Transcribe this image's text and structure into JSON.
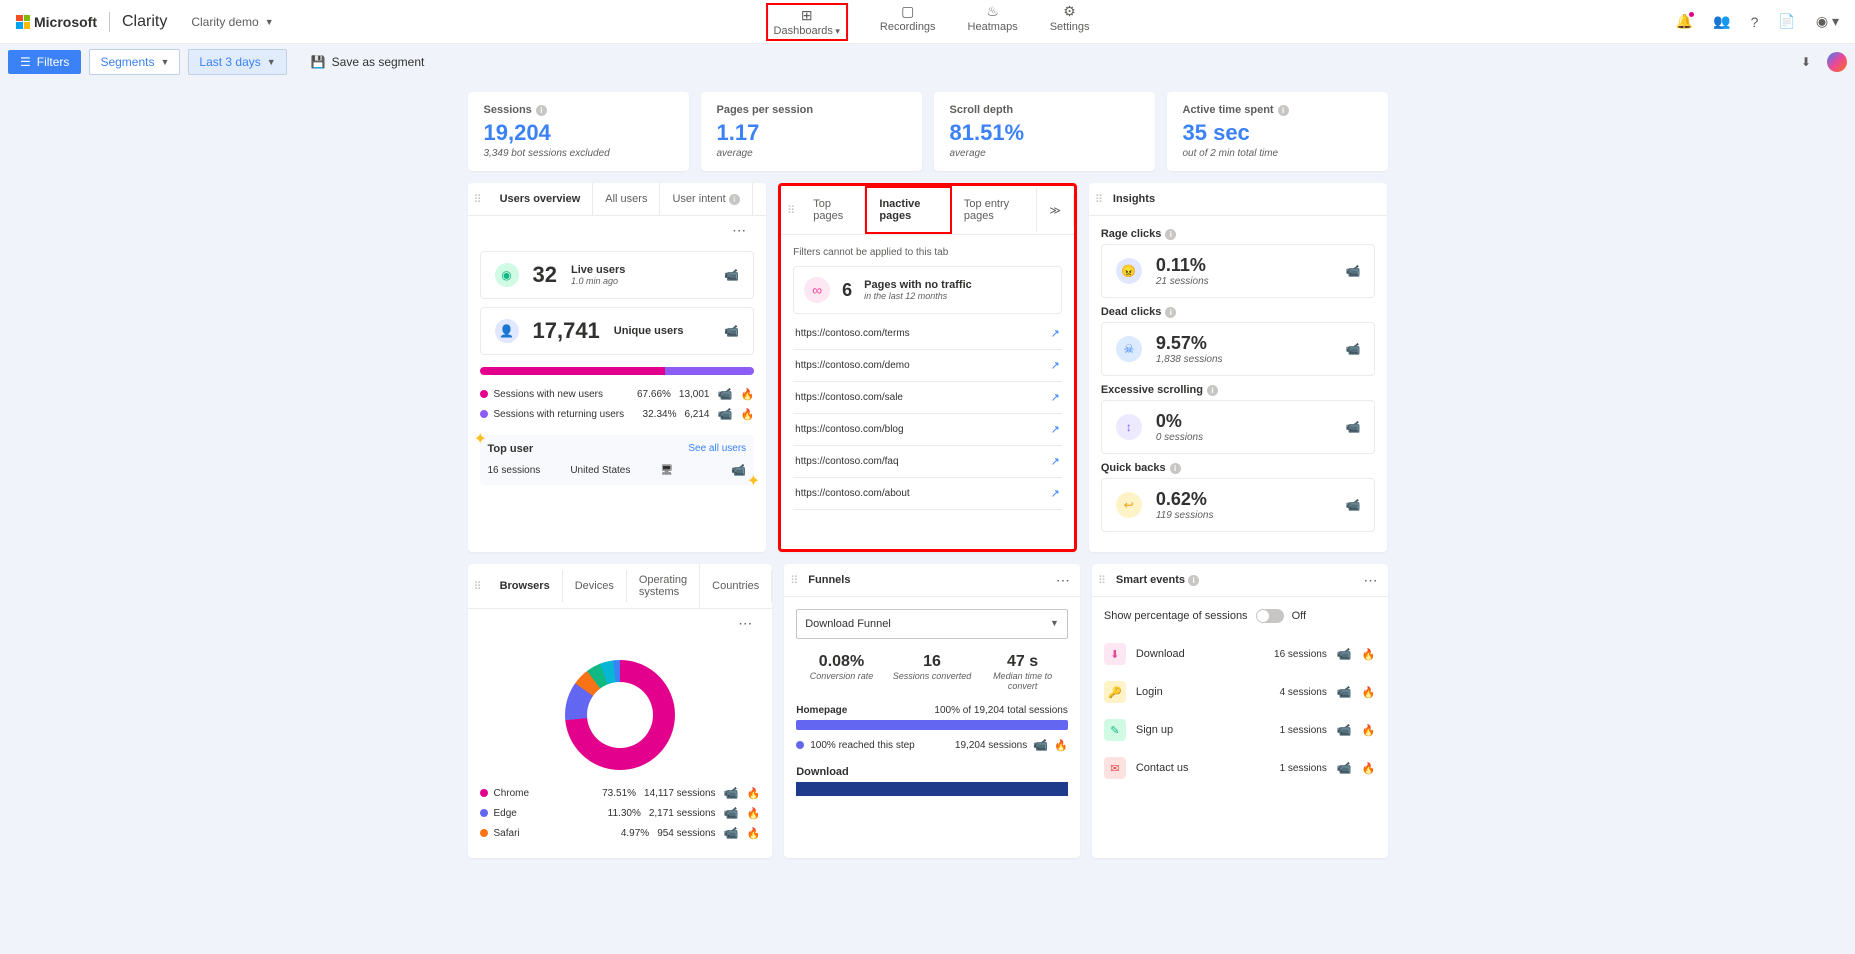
{
  "header": {
    "brand": "Microsoft",
    "product": "Clarity",
    "project": "Clarity demo",
    "nav": {
      "dashboards": "Dashboards",
      "recordings": "Recordings",
      "heatmaps": "Heatmaps",
      "settings": "Settings"
    }
  },
  "filterbar": {
    "filters": "Filters",
    "segments": "Segments",
    "date": "Last 3 days",
    "save_segment": "Save as segment"
  },
  "stats": {
    "sessions": {
      "label": "Sessions",
      "value": "19,204",
      "sub": "3,349 bot sessions excluded"
    },
    "pps": {
      "label": "Pages per session",
      "value": "1.17",
      "sub": "average"
    },
    "scroll": {
      "label": "Scroll depth",
      "value": "81.51%",
      "sub": "average"
    },
    "active": {
      "label": "Active time spent",
      "value": "35 sec",
      "sub": "out of 2 min total time"
    }
  },
  "users": {
    "tabs": {
      "overview": "Users overview",
      "all": "All users",
      "intent": "User intent"
    },
    "live": {
      "value": "32",
      "label": "Live users",
      "sub": "1.0 min ago"
    },
    "unique": {
      "value": "17,741",
      "label": "Unique users"
    },
    "new": {
      "label": "Sessions with new users",
      "pct": "67.66%",
      "count": "13,001"
    },
    "ret": {
      "label": "Sessions with returning users",
      "pct": "32.34%",
      "count": "6,214"
    },
    "topuser": {
      "title": "Top user",
      "see_all": "See all users",
      "sessions": "16 sessions",
      "country": "United States"
    }
  },
  "pages": {
    "tabs": {
      "top": "Top pages",
      "inactive": "Inactive pages",
      "entry": "Top entry pages"
    },
    "filter_note": "Filters cannot be applied to this tab",
    "head": {
      "value": "6",
      "label": "Pages with no traffic",
      "sub": "in the last 12 months"
    },
    "rows": [
      "https://contoso.com/terms",
      "https://contoso.com/demo",
      "https://contoso.com/sale",
      "https://contoso.com/blog",
      "https://contoso.com/faq",
      "https://contoso.com/about"
    ]
  },
  "insights": {
    "title": "Insights",
    "rage": {
      "label": "Rage clicks",
      "value": "0.11%",
      "sub": "21 sessions"
    },
    "dead": {
      "label": "Dead clicks",
      "value": "9.57%",
      "sub": "1,838 sessions"
    },
    "scroll": {
      "label": "Excessive scrolling",
      "value": "0%",
      "sub": "0 sessions"
    },
    "quick": {
      "label": "Quick backs",
      "value": "0.62%",
      "sub": "119 sessions"
    }
  },
  "browsers": {
    "tabs": {
      "browsers": "Browsers",
      "devices": "Devices",
      "os": "Operating systems",
      "countries": "Countries"
    },
    "rows": {
      "chrome": {
        "name": "Chrome",
        "pct": "73.51%",
        "sessions": "14,117 sessions"
      },
      "edge": {
        "name": "Edge",
        "pct": "11.30%",
        "sessions": "2,171 sessions"
      },
      "safari": {
        "name": "Safari",
        "pct": "4.97%",
        "sessions": "954 sessions"
      }
    }
  },
  "funnels": {
    "title": "Funnels",
    "select": "Download Funnel",
    "conv": {
      "value": "0.08%",
      "label": "Conversion rate"
    },
    "sess": {
      "value": "16",
      "label": "Sessions converted"
    },
    "time": {
      "value": "47 s",
      "label": "Median time to convert"
    },
    "step1": {
      "name": "Homepage",
      "right": "100% of 19,204 total sessions",
      "detail": "100% reached this step",
      "count": "19,204 sessions"
    },
    "step2": {
      "name": "Download"
    }
  },
  "events": {
    "title": "Smart events",
    "toggle_label": "Show percentage of sessions",
    "toggle_state": "Off",
    "rows": {
      "download": {
        "name": "Download",
        "sessions": "16 sessions"
      },
      "login": {
        "name": "Login",
        "sessions": "4 sessions"
      },
      "signup": {
        "name": "Sign up",
        "sessions": "1 sessions"
      },
      "contact": {
        "name": "Contact us",
        "sessions": "1 sessions"
      }
    }
  }
}
